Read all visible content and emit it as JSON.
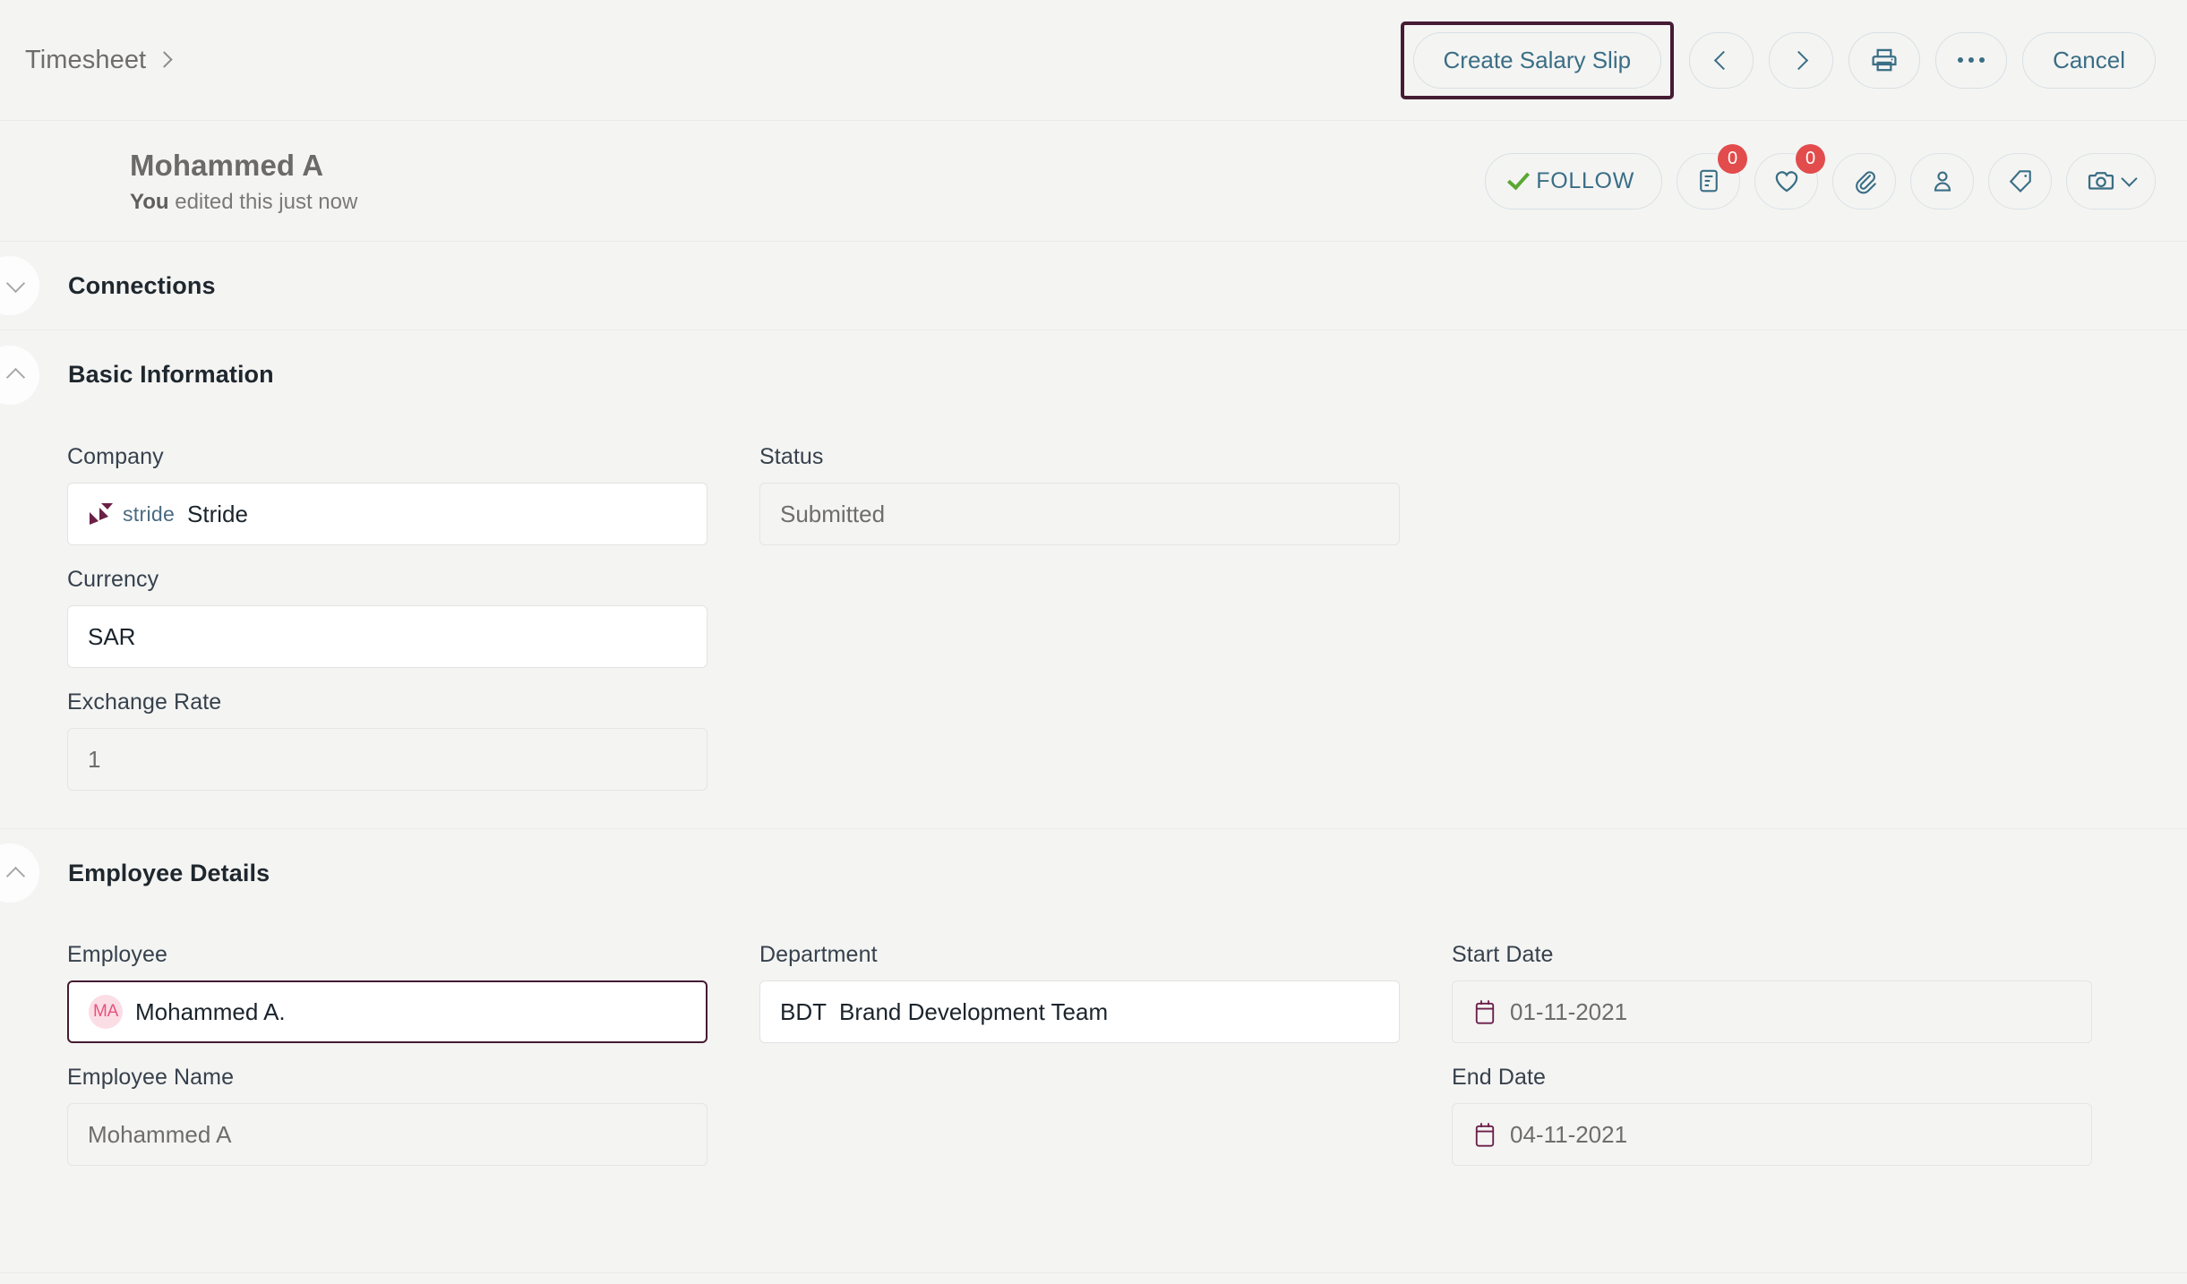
{
  "breadcrumb": {
    "label": "Timesheet",
    "separator_icon": "chevron-right-icon"
  },
  "toolbar": {
    "primary_label": "Create Salary Slip",
    "prev_icon": "chevron-left-icon",
    "next_icon": "chevron-right-icon",
    "print_icon": "print-icon",
    "more_icon": "ellipsis-icon",
    "cancel_label": "Cancel",
    "highlight_color": "#451c33",
    "accent_color": "#3a6e85"
  },
  "header": {
    "title": "Mohammed A",
    "edited_by": "You",
    "edited_text": " edited this just now",
    "follow_label": "FOLLOW",
    "follow_check_icon": "check-icon",
    "check_color": "#5aa832",
    "actions": [
      {
        "name": "comment-icon",
        "badge": "0"
      },
      {
        "name": "heart-icon",
        "badge": "0"
      },
      {
        "name": "paperclip-icon",
        "badge": null
      },
      {
        "name": "user-icon",
        "badge": null
      },
      {
        "name": "tag-icon",
        "badge": null
      },
      {
        "name": "camera-icon",
        "badge": null,
        "has_chevron": true
      }
    ],
    "badge_color": "#e24c4c"
  },
  "sections": [
    {
      "title": "Connections",
      "state": "collapsed",
      "chevron": "chevron-down-icon"
    },
    {
      "title": "Basic Information",
      "state": "expanded",
      "chevron": "chevron-up-icon"
    },
    {
      "title": "Employee Details",
      "state": "expanded",
      "chevron": "chevron-up-icon"
    }
  ],
  "basic_information": {
    "company": {
      "label": "Company",
      "value": "Stride",
      "logo_word": "stride",
      "logo_icon": "stride-logo-icon",
      "state": "editable"
    },
    "status": {
      "label": "Status",
      "value": "Submitted",
      "state": "disabled"
    },
    "currency": {
      "label": "Currency",
      "value": "SAR",
      "state": "editable"
    },
    "exchange_rate": {
      "label": "Exchange Rate",
      "value": "1",
      "state": "disabled"
    }
  },
  "employee_details": {
    "employee": {
      "label": "Employee",
      "value": "Mohammed A.",
      "avatar_initials": "MA",
      "avatar_bg": "#fbdde6",
      "avatar_fg": "#e8527d",
      "state": "focused"
    },
    "department": {
      "label": "Department",
      "abbr": "BDT",
      "value": "Brand Development Team",
      "state": "editable"
    },
    "start_date": {
      "label": "Start Date",
      "value": "01-11-2021",
      "icon": "calendar-icon",
      "state": "disabled"
    },
    "employee_name": {
      "label": "Employee Name",
      "value": "Mohammed A",
      "state": "disabled"
    },
    "end_date": {
      "label": "End Date",
      "value": "04-11-2021",
      "icon": "calendar-icon",
      "state": "disabled"
    }
  }
}
